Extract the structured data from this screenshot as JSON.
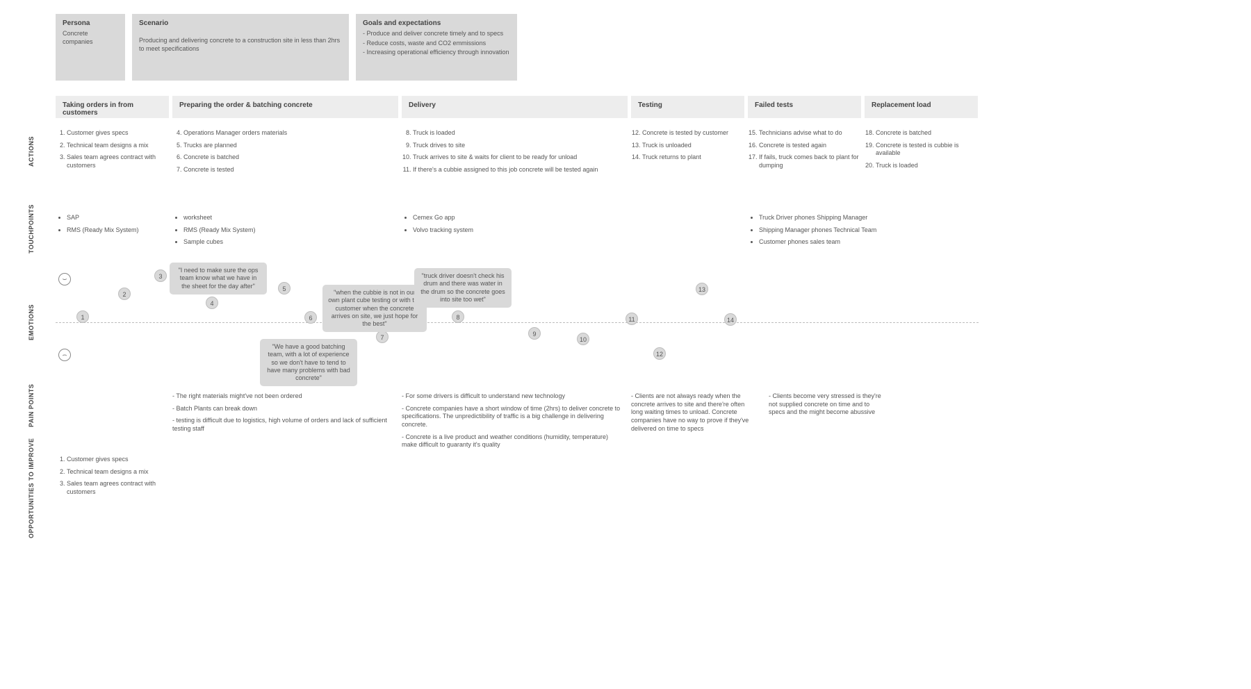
{
  "persona": {
    "title": "Persona",
    "body": "Concrete companies"
  },
  "scenario": {
    "title": "Scenario",
    "body": "Producing and delivering concrete to a construction site in less than 2hrs to meet specifications"
  },
  "goals": {
    "title": "Goals and expectations",
    "items": [
      "- Produce and deliver concrete timely and to specs",
      "- Reduce costs, waste and CO2 emmissions",
      "- Increasing operational efficiency through innovation"
    ]
  },
  "phases": [
    {
      "label": "Taking orders in from customers"
    },
    {
      "label": "Preparing the order & batching concrete"
    },
    {
      "label": "Delivery"
    },
    {
      "label": "Testing"
    },
    {
      "label": "Failed tests"
    },
    {
      "label": "Replacement load"
    }
  ],
  "rows": {
    "actions": "ACTIONS",
    "touchpoints": "TOUCHPOINTS",
    "emotions": "EMOTIONS",
    "pain": "PAIN POINTS",
    "opp": "OPPORTUNITIES TO IMPROVE"
  },
  "actions": {
    "c1": [
      "Customer gives specs",
      "Technical team designs a mix",
      "Sales team agrees contract with customers"
    ],
    "c2": [
      "Operations Manager orders materials",
      "Trucks are planned",
      "Concrete is batched",
      "Concrete is tested"
    ],
    "c3": [
      "Truck is loaded",
      "Truck drives to site",
      "Truck arrives to site & waits for client to be ready for unload",
      "If there's a cubbie assigned to this job concrete will be tested again"
    ],
    "c4": [
      "Concrete is tested by customer",
      "Truck is unloaded",
      "Truck returns to plant"
    ],
    "c5": [
      "Technicians advise what to do",
      "Concrete is tested again",
      "If fails, truck comes back to plant for dumping"
    ],
    "c6": [
      "Concrete is batched",
      "Concrete is tested is cubbie is available",
      "Truck is loaded"
    ]
  },
  "touchpoints": {
    "c1": [
      "SAP",
      "RMS (Ready Mix System)"
    ],
    "c2": [
      "worksheet",
      "RMS (Ready Mix System)",
      "Sample cubes"
    ],
    "c3": [
      "Cemex Go app",
      "Volvo tracking system"
    ],
    "c5": [
      "Truck Driver phones Shipping Manager",
      "Shipping Manager phones Technical Team",
      "Customer phones sales team"
    ]
  },
  "quotes": {
    "q1": "\"I need to make sure the ops team know what we have in the sheet for the day after\"",
    "q2": "\"We have a good batching team, with a lot of experience so we don't have to tend to have many problems with bad concrete\"",
    "q3": "\"when the cubbie is not in our own plant cube testing or with the customer when the concrete arrives on site, we just hope for the best\"",
    "q4": "\"truck driver doesn't check his drum and there was water in the drum so the concrete goes into site too wet\""
  },
  "pain": {
    "c2": [
      "- The right materials might've not been ordered",
      "- Batch Plants can break down",
      "- testing is difficult due to logistics, high volume of orders and lack of sufficient testing staff"
    ],
    "c3": [
      "- For some drivers is difficult to understand new technology",
      "- Concrete companies have a short window of time (2hrs) to deliver concrete to specifications. The unpredictibility of traffic is a big challenge in delivering concrete.",
      "- Concrete is a live product and weather conditions (humidity, temperature) make difficult to guaranty it's quality"
    ],
    "c4": [
      "- Clients are not always ready when the concrete arrives to site and there're often long waiting times to unload. Concrete companies have no way to prove if they've delivered on time to specs"
    ],
    "c5": [
      "- Clients become very stressed is they're not supplied concrete on time and to specs and the might become abussive"
    ]
  },
  "opp": {
    "c1": [
      "Customer gives specs",
      "Technical team designs a mix",
      "Sales team agrees contract with customers"
    ]
  }
}
